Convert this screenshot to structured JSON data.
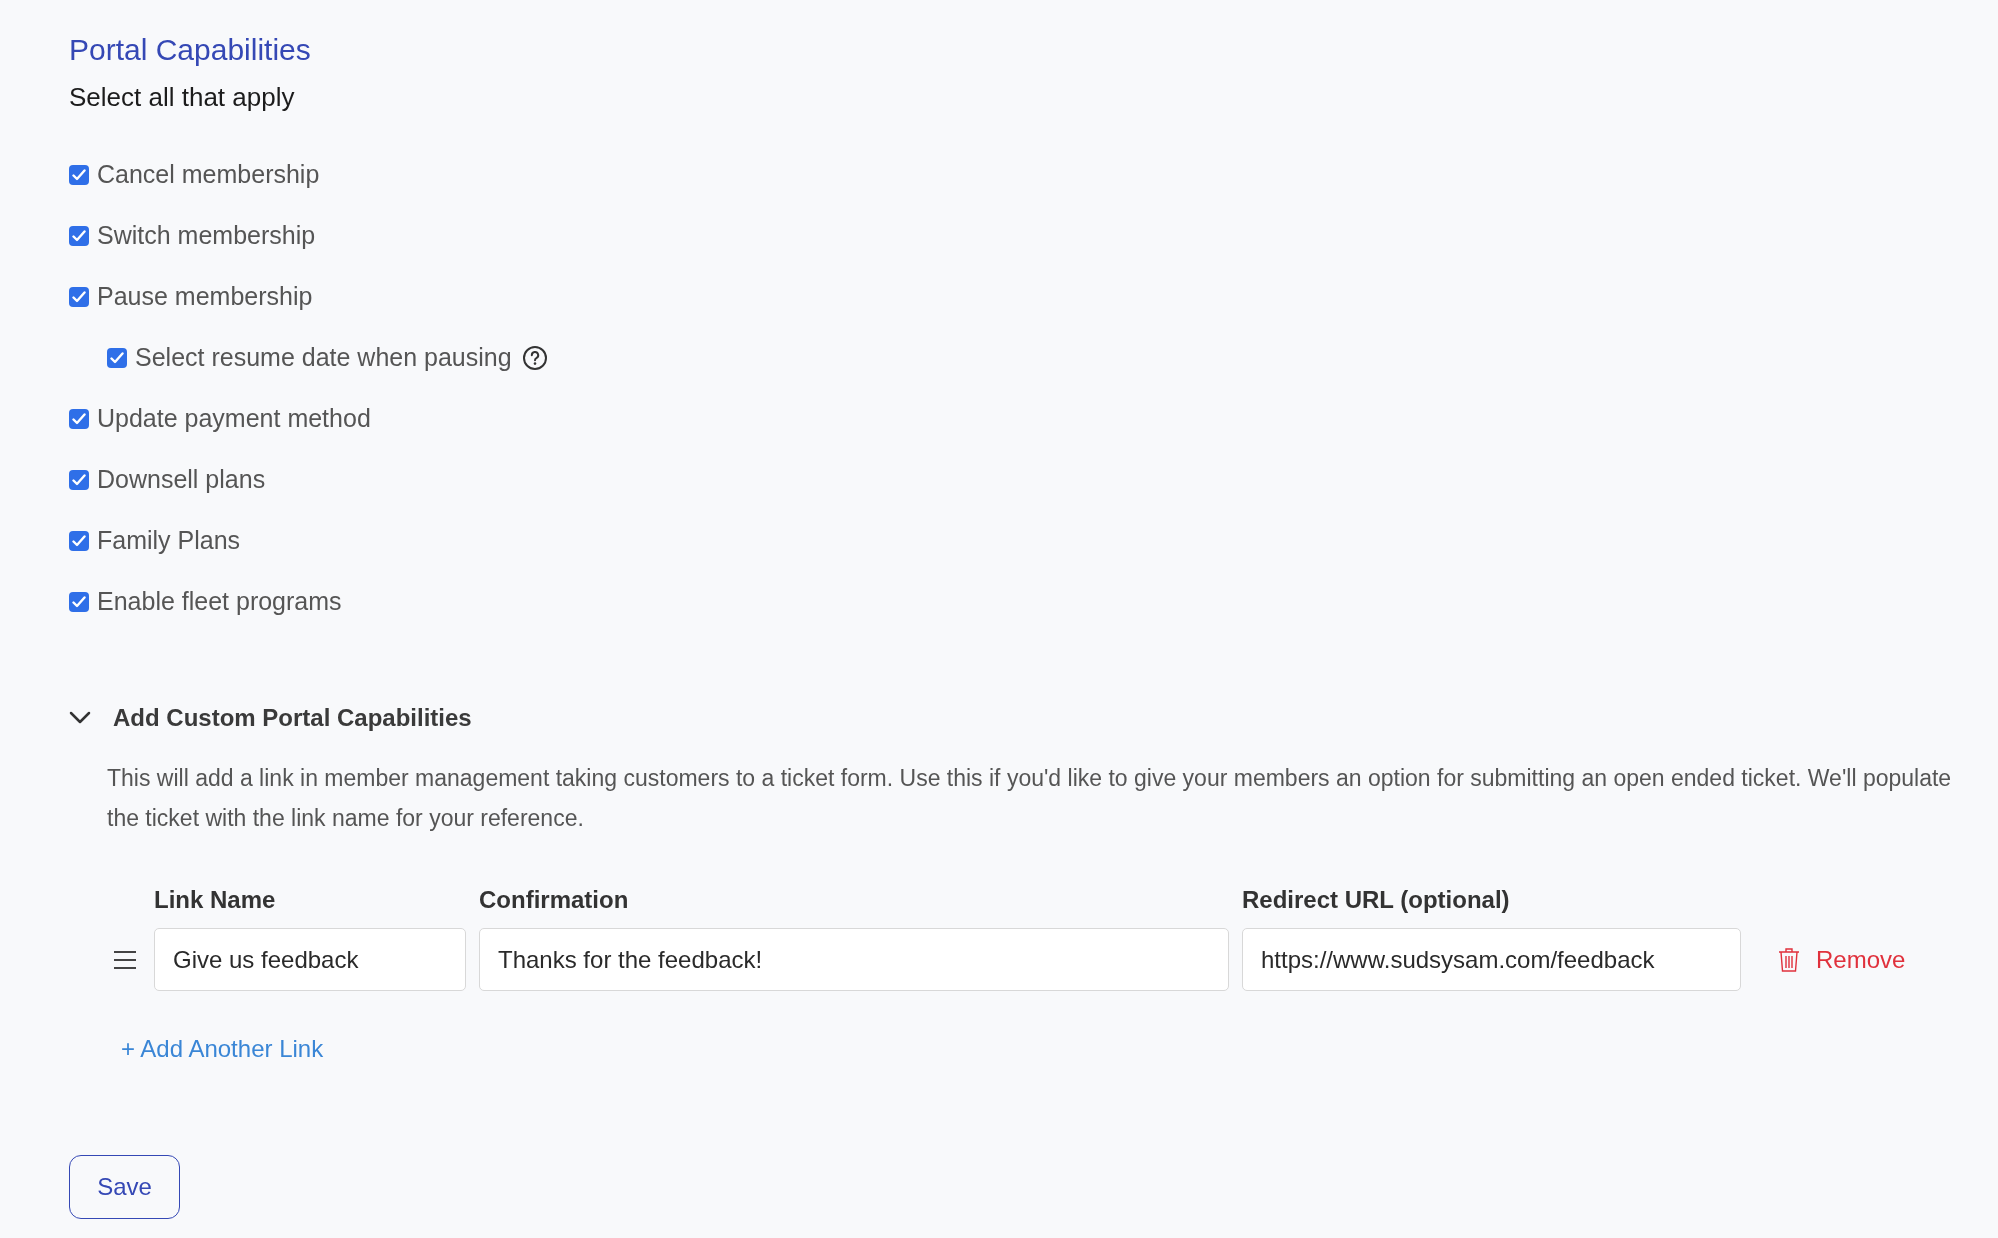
{
  "title": "Portal Capabilities",
  "subtitle": "Select all that apply",
  "options": [
    {
      "label": "Cancel membership",
      "checked": true
    },
    {
      "label": "Switch membership",
      "checked": true
    },
    {
      "label": "Pause membership",
      "checked": true,
      "children": [
        {
          "label": "Select resume date when pausing",
          "checked": true,
          "help": true
        }
      ]
    },
    {
      "label": "Update payment method",
      "checked": true
    },
    {
      "label": "Downsell plans",
      "checked": true
    },
    {
      "label": "Family Plans",
      "checked": true
    },
    {
      "label": "Enable fleet programs",
      "checked": true
    }
  ],
  "custom": {
    "title": "Add Custom Portal Capabilities",
    "expanded": true,
    "description": "This will add a link in member management taking customers to a ticket form. Use this if you'd like to give your members an option for submitting an open ended ticket. We'll populate the ticket with the link name for your reference.",
    "columns": [
      "Link Name",
      "Confirmation",
      "Redirect URL (optional)"
    ],
    "links": [
      {
        "name": "Give us feedback",
        "confirmation": "Thanks for the feedback!",
        "redirect": "https://www.sudsysam.com/feedback",
        "remove": "Remove"
      }
    ],
    "add_link": "+ Add Another Link"
  },
  "save": "Save"
}
